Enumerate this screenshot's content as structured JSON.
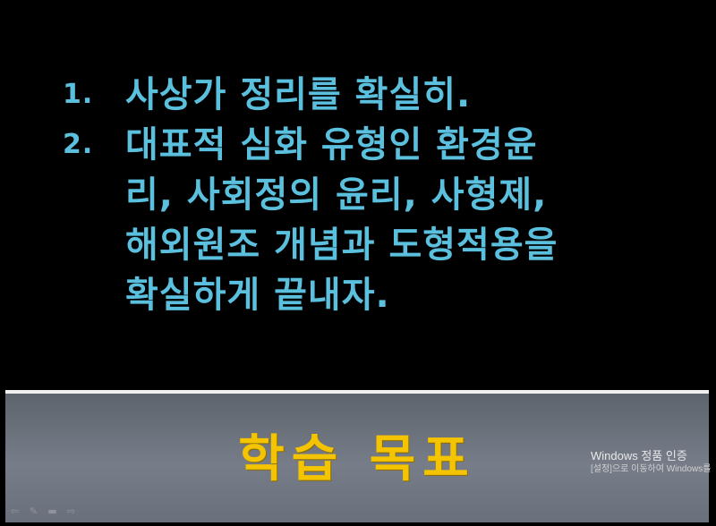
{
  "slide": {
    "items": [
      {
        "number": "1.",
        "text": "사상가 정리를 확실히."
      },
      {
        "number": "2.",
        "text": "대표적 심화 유형인 환경윤\n리, 사회정의 윤리, 사형제,\n해외원조 개념과 도형적용을\n확실하게 끝내자."
      }
    ],
    "title": "학습 목표"
  },
  "watermark": {
    "title": "Windows 정품 인증",
    "subtitle": "[설정]으로 이동하여 Windows를"
  },
  "controls": [
    {
      "icon": "arrow-left-icon",
      "glyph": "⇦"
    },
    {
      "icon": "pen-icon",
      "glyph": "✎"
    },
    {
      "icon": "slide-menu-icon",
      "glyph": "▬"
    },
    {
      "icon": "arrow-right-icon",
      "glyph": "⇨"
    }
  ],
  "colors": {
    "text": "#5bc0de",
    "title": "#f5c400",
    "background": "#000000"
  }
}
